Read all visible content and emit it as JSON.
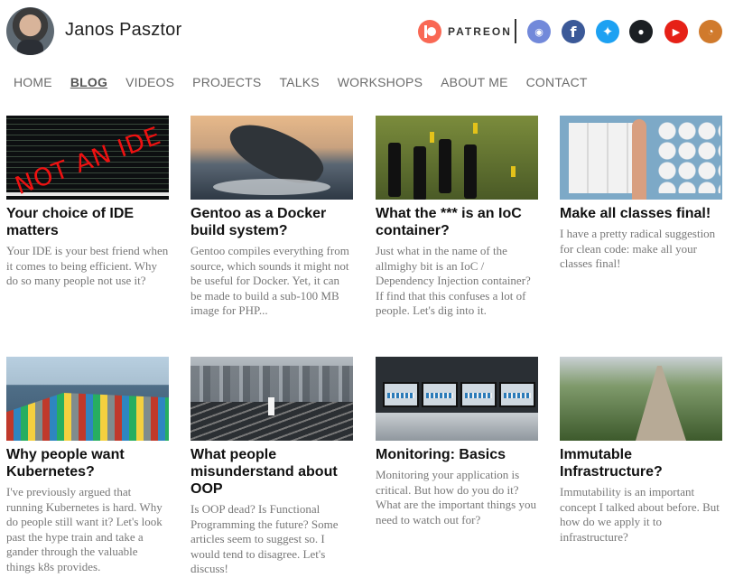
{
  "site": {
    "author_name": "Janos Pasztor"
  },
  "social": {
    "patreon_label": "PATREON",
    "icons": [
      "patreon-icon",
      "discord-icon",
      "facebook-icon",
      "twitter-icon",
      "github-icon",
      "youtube-icon",
      "rss-icon"
    ],
    "colors": {
      "patreon": "#f96854",
      "discord": "#7289da",
      "facebook": "#3b5998",
      "twitter": "#1da1f2",
      "github": "#1b1f23",
      "youtube": "#e62117",
      "rss": "#d07a2c"
    }
  },
  "nav": {
    "items": [
      {
        "label": "HOME"
      },
      {
        "label": "BLOG",
        "active": true
      },
      {
        "label": "VIDEOS"
      },
      {
        "label": "PROJECTS"
      },
      {
        "label": "TALKS"
      },
      {
        "label": "WORKSHOPS"
      },
      {
        "label": "ABOUT ME"
      },
      {
        "label": "CONTACT"
      }
    ]
  },
  "posts": [
    {
      "title": "Your choice of IDE matters",
      "excerpt": "Your IDE is your best friend when it comes to being efficient. Why do so many people not use it?",
      "image_text": "NOT AN IDE"
    },
    {
      "title": "Gentoo as a Docker build system?",
      "excerpt": "Gentoo compiles everything from source, which sounds it might not be useful for Docker. Yet, it can be made to build a sub-100 MB image for PHP..."
    },
    {
      "title": "What the *** is an IoC container?",
      "excerpt": "Just what in the name of the allmighy bit is an IoC / Dependency Injection container? If find that this confuses a lot of people. Let's dig into it."
    },
    {
      "title": "Make all classes final!",
      "excerpt": "I have a pretty radical suggestion for clean code: make all your classes final!"
    },
    {
      "title": "Why people want Kubernetes?",
      "excerpt": "I've previously argued that running Kubernetes is hard. Why do people still want it? Let's look past the hype train and take a gander through the valuable things k8s provides."
    },
    {
      "title": "What people misunderstand about OOP",
      "excerpt": "Is OOP dead? Is Functional Programming the future? Some articles seem to suggest so. I would tend to disagree. Let's discuss!"
    },
    {
      "title": "Monitoring: Basics",
      "excerpt": "Monitoring your application is critical. But how do you do it? What are the important things you need to watch out for?"
    },
    {
      "title": "Immutable Infrastructure?",
      "excerpt": "Immutability is an important concept I talked about before. But how do we apply it to infrastructure?"
    }
  ]
}
